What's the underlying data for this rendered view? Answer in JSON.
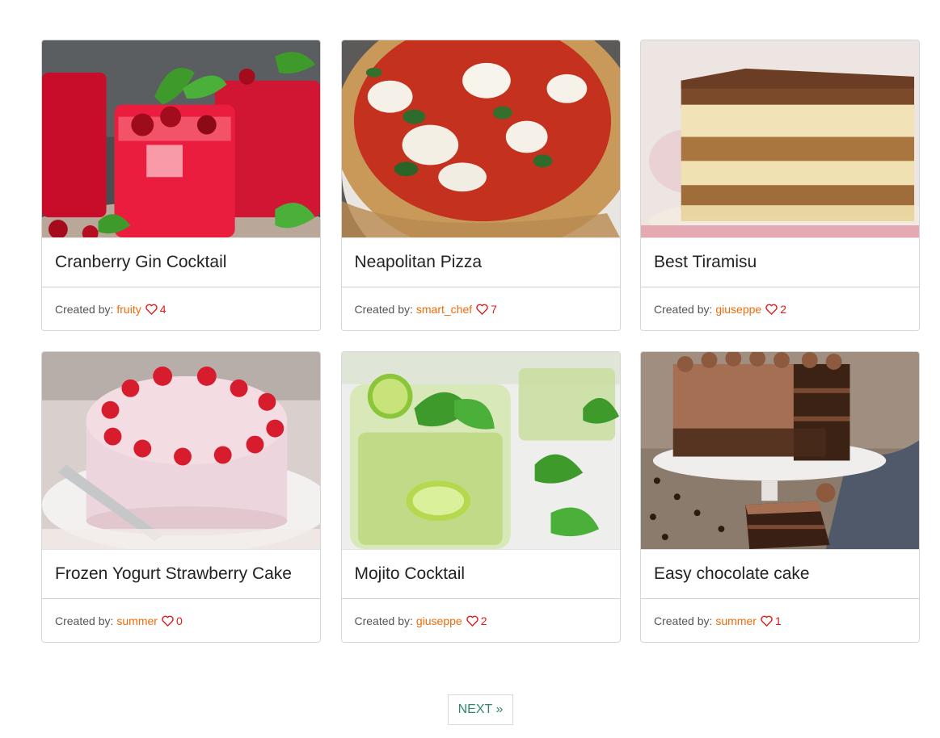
{
  "recipes": [
    {
      "title": "Cranberry Gin Cocktail",
      "created_by_label": "Created by:",
      "author": "fruity",
      "likes": "4"
    },
    {
      "title": "Neapolitan Pizza",
      "created_by_label": "Created by:",
      "author": "smart_chef",
      "likes": "7"
    },
    {
      "title": "Best Tiramisu",
      "created_by_label": "Created by:",
      "author": "giuseppe",
      "likes": "2"
    },
    {
      "title": "Frozen Yogurt Strawberry Cake",
      "created_by_label": "Created by:",
      "author": "summer",
      "likes": "0"
    },
    {
      "title": "Mojito Cocktail",
      "created_by_label": "Created by:",
      "author": "giuseppe",
      "likes": "2"
    },
    {
      "title": "Easy chocolate cake",
      "created_by_label": "Created by:",
      "author": "summer",
      "likes": "1"
    }
  ],
  "pagination": {
    "next_label": "NEXT »"
  },
  "colors": {
    "author": "#f06a0a",
    "heart": "#e31818",
    "next": "#2e8a68",
    "border": "#d6d6d6"
  },
  "icons": {
    "like": "heart-outline-icon"
  }
}
